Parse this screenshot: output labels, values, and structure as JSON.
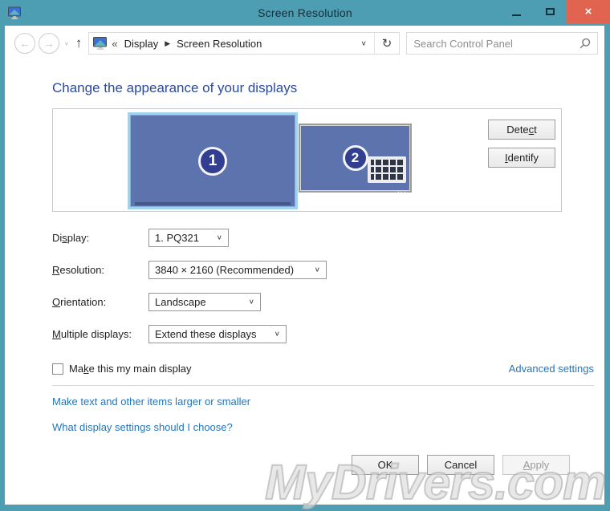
{
  "window": {
    "title": "Screen Resolution",
    "close_glyph": "×"
  },
  "navbar": {
    "back_glyph": "←",
    "forward_glyph": "→",
    "small_drop_glyph": "∨",
    "up_glyph": "↑",
    "breadcrumb": {
      "chevrons": "«",
      "separator": "▶",
      "items": [
        "Display",
        "Screen Resolution"
      ],
      "dropdown_glyph": "∨",
      "refresh_glyph": "↻"
    },
    "search": {
      "placeholder": "Search Control Panel"
    }
  },
  "main": {
    "heading": "Change the appearance of your displays",
    "preview": {
      "monitor1_label": "1",
      "monitor2_label": "2",
      "detect": {
        "pre": "Dete",
        "key": "c",
        "post": "t"
      },
      "identify": {
        "pre": "",
        "key": "I",
        "post": "dentify"
      }
    },
    "fields": {
      "display": {
        "label": {
          "pre": "Di",
          "key": "s",
          "post": "play:"
        },
        "value": "1. PQ321"
      },
      "resolution": {
        "label": {
          "pre": "",
          "key": "R",
          "post": "esolution:"
        },
        "value": "3840 × 2160 (Recommended)"
      },
      "orientation": {
        "label": {
          "pre": "",
          "key": "O",
          "post": "rientation:"
        },
        "value": "Landscape"
      },
      "multiple_displays": {
        "label": {
          "pre": "",
          "key": "M",
          "post": "ultiple displays:"
        },
        "value": "Extend these displays"
      }
    },
    "main_display_checkbox": {
      "checked": false,
      "label": {
        "pre": "Ma",
        "key": "k",
        "post": "e this my main display"
      }
    },
    "links": {
      "advanced": "Advanced settings",
      "larger_smaller": "Make text and other items larger or smaller",
      "which_settings": "What display settings should I choose?"
    }
  },
  "footer": {
    "ok": "OK",
    "cancel": "Cancel",
    "apply": {
      "pre": "",
      "key": "A",
      "post": "pply"
    }
  },
  "watermark": "MyDrivers.com",
  "colors": {
    "titlebar": "#4d9db3",
    "close_button": "#e0644f",
    "heading": "#2b4a9e",
    "link": "#2475bc",
    "monitor_fill": "#5c73ad",
    "monitor_number_circle": "#323e90",
    "selected_monitor_border": "#9ed3f2"
  }
}
